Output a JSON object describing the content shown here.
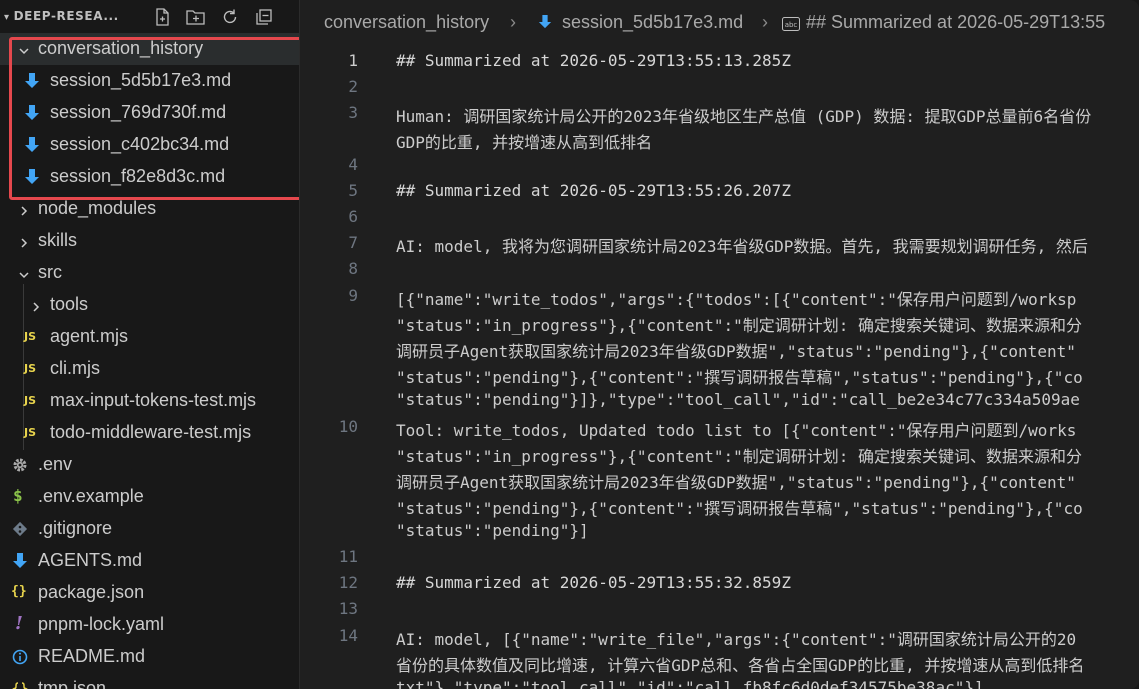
{
  "explorer": {
    "title": "DEEP-RESEA...",
    "actions": [
      "new-file-icon",
      "new-folder-icon",
      "refresh-icon",
      "collapse-all-icon"
    ],
    "items": [
      {
        "label": "conversation_history",
        "kind": "folder",
        "expanded": true
      },
      {
        "label": "session_5d5b17e3.md",
        "kind": "markdown"
      },
      {
        "label": "session_769d730f.md",
        "kind": "markdown"
      },
      {
        "label": "session_c402bc34.md",
        "kind": "markdown"
      },
      {
        "label": "session_f82e8d3c.md",
        "kind": "markdown"
      },
      {
        "label": "node_modules",
        "kind": "folder",
        "expanded": false
      },
      {
        "label": "skills",
        "kind": "folder",
        "expanded": false
      },
      {
        "label": "src",
        "kind": "folder",
        "expanded": true
      },
      {
        "label": "tools",
        "kind": "folder",
        "expanded": false
      },
      {
        "label": "agent.mjs",
        "kind": "js",
        "badge": "JS"
      },
      {
        "label": "cli.mjs",
        "kind": "js",
        "badge": "JS"
      },
      {
        "label": "max-input-tokens-test.mjs",
        "kind": "js",
        "badge": "JS"
      },
      {
        "label": "todo-middleware-test.mjs",
        "kind": "js",
        "badge": "JS"
      },
      {
        "label": ".env",
        "kind": "gear"
      },
      {
        "label": ".env.example",
        "kind": "dollar",
        "badge": "$"
      },
      {
        "label": ".gitignore",
        "kind": "git"
      },
      {
        "label": "AGENTS.md",
        "kind": "markdown"
      },
      {
        "label": "package.json",
        "kind": "json",
        "badge": "{}"
      },
      {
        "label": "pnpm-lock.yaml",
        "kind": "yaml",
        "badge": "!"
      },
      {
        "label": "README.md",
        "kind": "info"
      },
      {
        "label": "tmp.json",
        "kind": "json"
      }
    ]
  },
  "breadcrumbs": {
    "folder": "conversation_history",
    "file": "session_5d5b17e3.md",
    "symbol": "## Summarized at 2026-05-29T13:55"
  },
  "editor": {
    "line_numbers": [
      "1",
      "2",
      "3",
      "4",
      "5",
      "6",
      "7",
      "8",
      "9",
      "10",
      "11",
      "12",
      "13",
      "14"
    ],
    "lines": [
      {
        "text": "## Summarized at 2026-05-29T13:55:13.285Z",
        "type": "heading"
      },
      {
        "text": "Human: 调研国家统计局公开的2023年省级地区生产总值 (GDP) 数据: 提取GDP总量前6名省份",
        "type": "prose"
      },
      {
        "text": "GDP的比重, 并按增速从高到低排名",
        "type": "prose"
      },
      {
        "text": "## Summarized at 2026-05-29T13:55:26.207Z",
        "type": "heading"
      },
      {
        "text": "AI: model, 我将为您调研国家统计局2023年省级GDP数据。首先, 我需要规划调研任务, 然后",
        "type": "prose"
      },
      {
        "text": "[{\"name\":\"write_todos\",\"args\":{\"todos\":[{\"content\":\"保存用户问题到/worksp",
        "type": "json"
      },
      {
        "text": "\"status\":\"in_progress\"},{\"content\":\"制定调研计划: 确定搜索关键词、数据来源和分",
        "type": "json"
      },
      {
        "text": "调研员子Agent获取国家统计局2023年省级GDP数据\",\"status\":\"pending\"},{\"content\"",
        "type": "json"
      },
      {
        "text": "\"status\":\"pending\"},{\"content\":\"撰写调研报告草稿\",\"status\":\"pending\"},{\"co",
        "type": "json"
      },
      {
        "text": "\"status\":\"pending\"}]},\"type\":\"tool_call\",\"id\":\"call_be2e34c77c334a509ae",
        "type": "json"
      },
      {
        "text": "Tool: write_todos, Updated todo list to [{\"content\":\"保存用户问题到/works",
        "type": "json"
      },
      {
        "text": "\"status\":\"in_progress\"},{\"content\":\"制定调研计划: 确定搜索关键词、数据来源和分",
        "type": "json"
      },
      {
        "text": "调研员子Agent获取国家统计局2023年省级GDP数据\",\"status\":\"pending\"},{\"content\"",
        "type": "json"
      },
      {
        "text": "\"status\":\"pending\"},{\"content\":\"撰写调研报告草稿\",\"status\":\"pending\"},{\"co",
        "type": "json"
      },
      {
        "text": "\"status\":\"pending\"}]",
        "type": "json"
      },
      {
        "text": "## Summarized at 2026-05-29T13:55:32.859Z",
        "type": "heading"
      },
      {
        "text": "AI: model, [{\"name\":\"write_file\",\"args\":{\"content\":\"调研国家统计局公开的20",
        "type": "json"
      },
      {
        "text": "省份的具体数值及同比增速, 计算六省GDP总和、各省占全国GDP的比重, 并按增速从高到低排名",
        "type": "json"
      },
      {
        "text": "txt\"},\"type\":\"tool_call\",\"id\":\"call_fb8fc6d0def34575be38ac\"}]",
        "type": "json"
      }
    ]
  },
  "colors": {
    "accent_highlight": "#e5484d",
    "markdown_icon": "#42a5f5",
    "json_string": "#b8a3ff"
  }
}
